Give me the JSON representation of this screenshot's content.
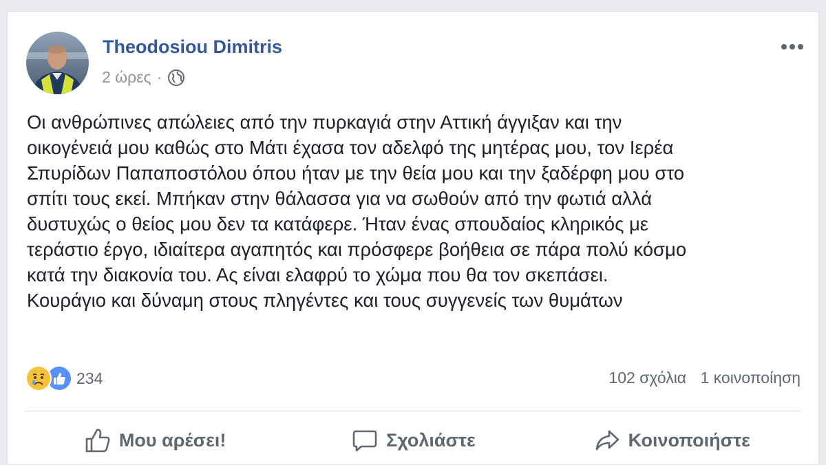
{
  "post": {
    "author": "Theodosiou Dimitris",
    "timestamp": "2 ώρες",
    "separator": "·",
    "privacy_icon": "globe-icon",
    "text_lines": [
      "Οι ανθρώπινες απώλειες από την πυρκαγιά στην Αττική άγγιξαν και την",
      "οικογένειά μου καθώς στο Μάτι έχασα τον αδελφό της μητέρας μου, τον Ιερέα",
      "Σπυρίδων Παπαποστόλου όπου ήταν με την θεία μου και την ξαδέρφη μου στο",
      "σπίτι τους εκεί. Μπήκαν στην θάλασσα για να σωθούν από την φωτιά αλλά",
      "δυστυχώς ο θείος μου δεν τα κατάφερε. Ήταν ένας σπουδαίος κληρικός με",
      "τεράστιο έργο, ιδιαίτερα αγαπητός και πρόσφερε βοήθεια σε πάρα πολύ κόσμο",
      "κατά την διακονία του. Ας είναι ελαφρύ το χώμα που θα τον σκεπάσει.",
      "Κουράγιο και δύναμη στους πληγέντες και τους συγγενείς των θυμάτων"
    ]
  },
  "reactions": {
    "count": "234",
    "icons": [
      "sad-reaction-icon",
      "like-reaction-icon"
    ]
  },
  "stats": {
    "comments": "102 σχόλια",
    "shares": "1 κοινοποίηση"
  },
  "actions": {
    "like": "Μου αρέσει!",
    "comment": "Σχολιάστε",
    "share": "Κοινοποιήστε"
  },
  "colors": {
    "author_link": "#365899",
    "meta_text": "#90949c",
    "body_text": "#1d2129",
    "action_text": "#606770",
    "like_blue": "#5890ff",
    "sad_yellow": "#f5c33b"
  }
}
